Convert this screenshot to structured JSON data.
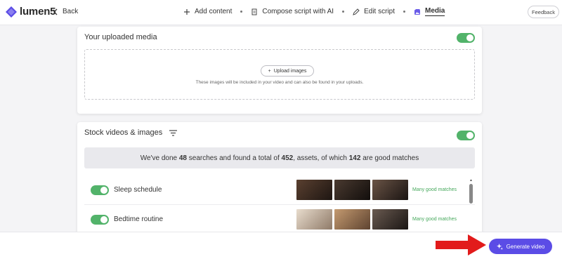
{
  "header": {
    "logo_text": "lumen5",
    "back_label": "Back",
    "steps": [
      {
        "label": "Add content",
        "icon": "plus-icon"
      },
      {
        "label": "Compose script with AI",
        "icon": "document-icon"
      },
      {
        "label": "Edit script",
        "icon": "pencil-icon"
      },
      {
        "label": "Media",
        "icon": "media-icon"
      }
    ],
    "active_step": "Media",
    "feedback_label": "Feedback"
  },
  "uploaded_media": {
    "title": "Your uploaded media",
    "toggle_on": true,
    "upload_button": "Upload images",
    "note": "These images will be included in your video and can also be found in your uploads."
  },
  "stock": {
    "title": "Stock videos & images",
    "toggle_on": true,
    "summary": {
      "prefix": "We've done",
      "searches": "48",
      "mid1": "searches and found a total of",
      "assets": "452",
      "mid2": "assets, of which",
      "good": "142",
      "suffix": "are good matches"
    },
    "rows": [
      {
        "label": "Sleep schedule",
        "enabled": true,
        "match": "Many good matches",
        "thumb_colors": [
          "#3a2a22",
          "#2b2320",
          "#3b2e2a"
        ]
      },
      {
        "label": "Bedtime routine",
        "enabled": true,
        "match": "Many good matches",
        "thumb_colors": [
          "#c9b7a3",
          "#9b7a5e",
          "#3a3330"
        ]
      }
    ]
  },
  "footer": {
    "generate_label": "Generate video"
  },
  "colors": {
    "accent": "#5b4ce6",
    "toggle": "#52b36a",
    "match_text": "#46a85c",
    "arrow": "#e21b1b"
  }
}
